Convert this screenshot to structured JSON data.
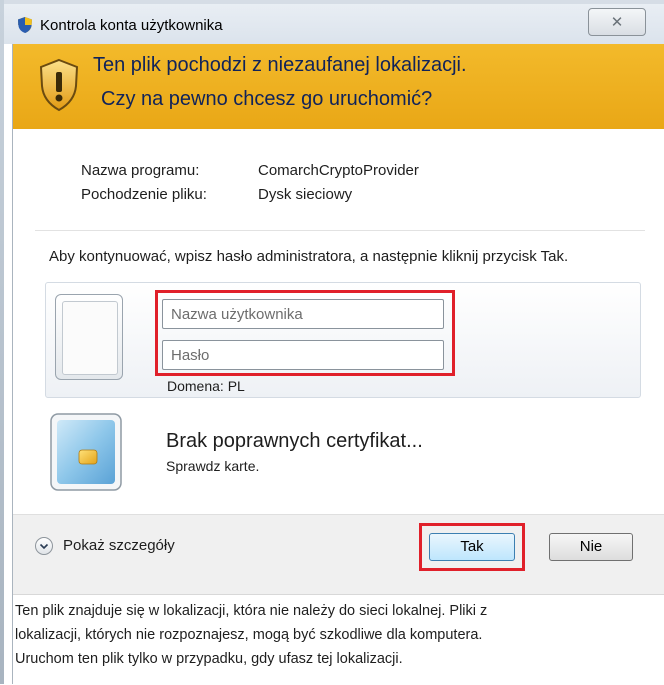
{
  "window": {
    "title": "Kontrola konta użytkownika",
    "close_glyph": "✕"
  },
  "banner": {
    "line1": "Ten plik pochodzi z niezaufanej lokalizacji.",
    "line2": "Czy na pewno chcesz go uruchomić?",
    "icon": "warning-shield-icon",
    "color": "#f0b020"
  },
  "info": {
    "program_label": "Nazwa programu:",
    "program_value": "ComarchCryptoProvider",
    "origin_label": "Pochodzenie pliku:",
    "origin_value": "Dysk sieciowy"
  },
  "instruction": "Aby kontynuować, wpisz hasło administratora, a następnie kliknij przycisk Tak.",
  "credentials": {
    "username_placeholder": "Nazwa użytkownika",
    "username_value": "",
    "password_placeholder": "Hasło",
    "password_value": "",
    "domain": "Domena: PL"
  },
  "smartcard": {
    "title": "Brak poprawnych certyfikat...",
    "subtitle": "Sprawdz karte.",
    "icon": "smart-card-icon"
  },
  "footer": {
    "details_label": "Pokaż szczegóły",
    "yes_label": "Tak",
    "no_label": "Nie"
  },
  "note": {
    "line1": "Ten plik znajduje się w lokalizacji, która nie należy do sieci lokalnej. Pliki z",
    "line2": "lokalizacji, których nie rozpoznajesz, mogą być szkodliwe dla komputera.",
    "line3": "Uruchom ten plik tylko w przypadku, gdy ufasz tej lokalizacji."
  },
  "highlight_color": "#e0202a"
}
